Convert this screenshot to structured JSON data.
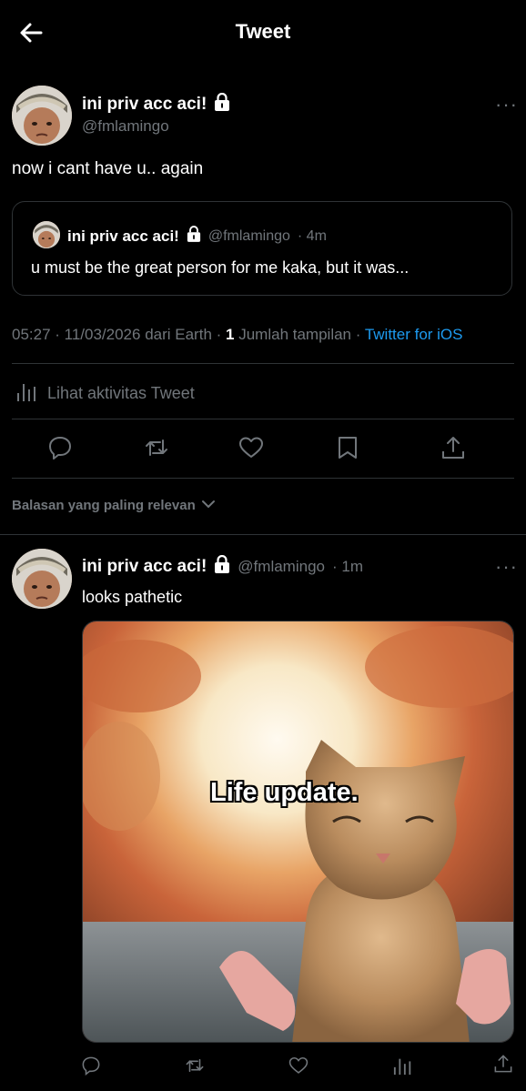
{
  "header": {
    "title": "Tweet"
  },
  "tweet": {
    "name": "ini priv acc aci!",
    "handle": "@fmlamingo",
    "text": "now i cant have u.. again",
    "more": "···"
  },
  "quote": {
    "name": "ini priv acc aci!",
    "handle": "@fmlamingo",
    "time": "· 4m",
    "text": "u must be the great person for me kaka, but it was..."
  },
  "meta": {
    "time": "05:27 · 11/03/2026 dari Earth ·",
    "views_count": "1",
    "views_label": "Jumlah tampilan ·",
    "source": "Twitter for iOS"
  },
  "activity": {
    "label": "Lihat aktivitas Tweet"
  },
  "actions": [
    "reply-icon",
    "retweet-icon",
    "like-icon",
    "bookmark-icon",
    "share-icon"
  ],
  "sort": {
    "label": "Balasan yang paling relevan"
  },
  "reply": {
    "name": "ini priv acc aci!",
    "handle": "@fmlamingo",
    "time": "· 1m",
    "text": "looks pathetic",
    "more": "···",
    "media_caption": "Life update."
  },
  "colors": {
    "accent": "#1d9bf0",
    "muted": "#71767b",
    "border": "#2f3336"
  }
}
